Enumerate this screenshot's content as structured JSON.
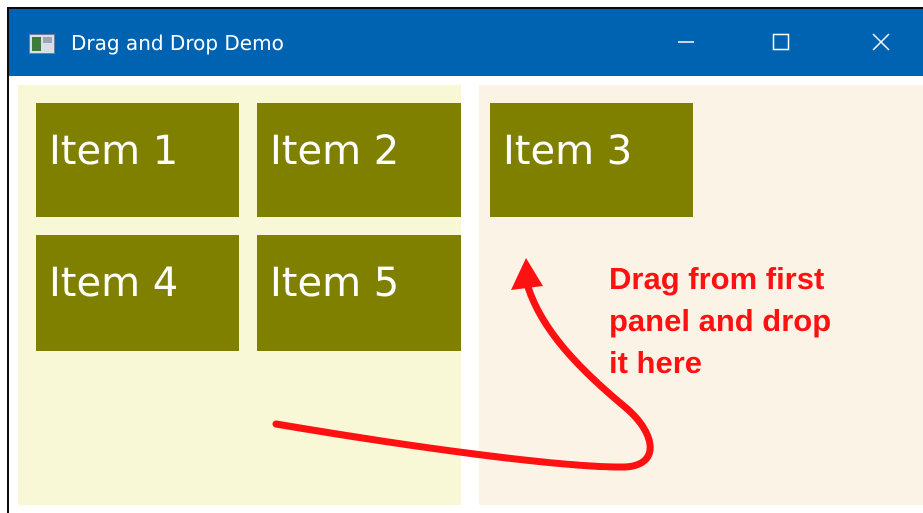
{
  "window": {
    "title": "Drag and Drop Demo",
    "titlebar_color": "#0063b1",
    "icon": "app-window-icon",
    "controls": {
      "minimize_icon": "minimize-icon",
      "maximize_icon": "maximize-icon",
      "close_icon": "close-icon"
    }
  },
  "source_panel": {
    "background": "#f8f8d7",
    "items": [
      {
        "label": "Item 1"
      },
      {
        "label": "Item 2"
      },
      {
        "label": "Item 4"
      },
      {
        "label": "Item 5"
      }
    ]
  },
  "target_panel": {
    "background": "#fcf3e7",
    "items": [
      {
        "label": "Item 3"
      }
    ]
  },
  "item_color": "#808000",
  "annotation": {
    "text": "Drag from first\npanel and drop\nit here",
    "color": "#ff1111",
    "arrow_icon": "curved-arrow-icon"
  }
}
